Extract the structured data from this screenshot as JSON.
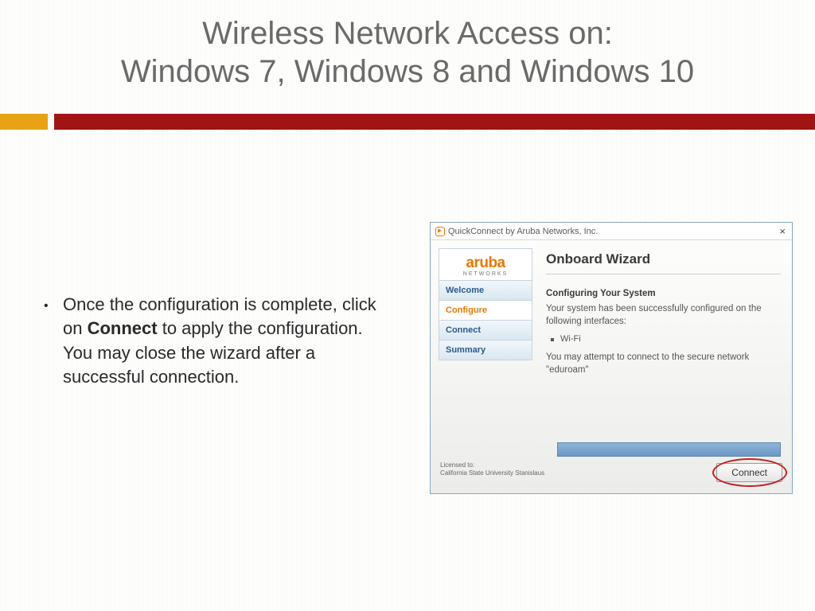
{
  "title": {
    "line1": "Wireless Network Access on:",
    "line2": "Windows 7, Windows 8 and Windows 10"
  },
  "bullet": {
    "prefix": "Once the configuration is complete, click on ",
    "bold": "Connect",
    "suffix": " to apply the configuration. You may close the wizard after a successful connection."
  },
  "wizard": {
    "window_title": "QuickConnect by Aruba Networks, Inc.",
    "close_glyph": "×",
    "logo_main": "aruba",
    "logo_sub": "NETWORKS",
    "nav": {
      "welcome": "Welcome",
      "configure": "Configure",
      "connect": "Connect",
      "summary": "Summary"
    },
    "heading": "Onboard Wizard",
    "subheading": "Configuring Your System",
    "msg1": "Your system has been successfully configured on the following interfaces:",
    "interface": "Wi-Fi",
    "msg2": "You may attempt to connect to the secure network \"eduroam\"",
    "license_label": "Licensed to:",
    "license_org": "California State University Stanislaus",
    "connect_label": "Connect"
  }
}
